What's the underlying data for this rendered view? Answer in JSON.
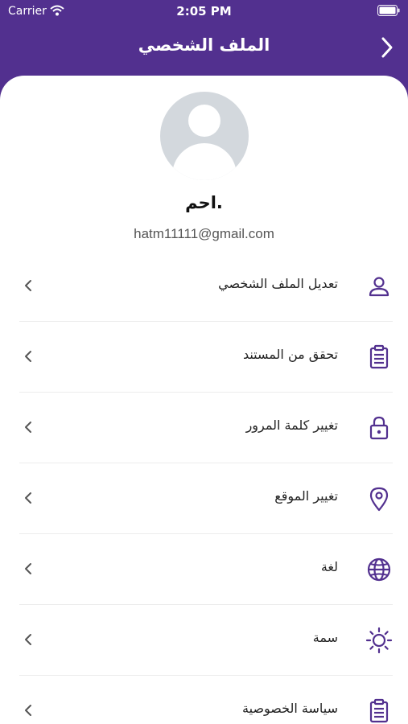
{
  "status_bar": {
    "carrier": "Carrier",
    "time": "2:05 PM"
  },
  "header": {
    "title": "الملف الشخصي",
    "back_icon": "chevron-right-icon"
  },
  "profile": {
    "name": "احم.",
    "email": "hatm11111@gmail.com",
    "avatar_icon": "default-user-avatar"
  },
  "menu": {
    "items": [
      {
        "label": "تعديل الملف الشخصي",
        "icon": "user-icon"
      },
      {
        "label": "تحقق من المستند",
        "icon": "clipboard-icon"
      },
      {
        "label": "تغيير كلمة المرور",
        "icon": "lock-icon"
      },
      {
        "label": "تغيير الموقع",
        "icon": "location-pin-icon"
      },
      {
        "label": "لغة",
        "icon": "globe-icon"
      },
      {
        "label": "سمة",
        "icon": "sun-icon"
      },
      {
        "label": "سياسة الخصوصية",
        "icon": "clipboard-icon"
      }
    ]
  },
  "colors": {
    "primary": "#52308f",
    "icon": "#52308f",
    "chevron": "#555555",
    "avatar_bg": "#d3d8dd"
  }
}
